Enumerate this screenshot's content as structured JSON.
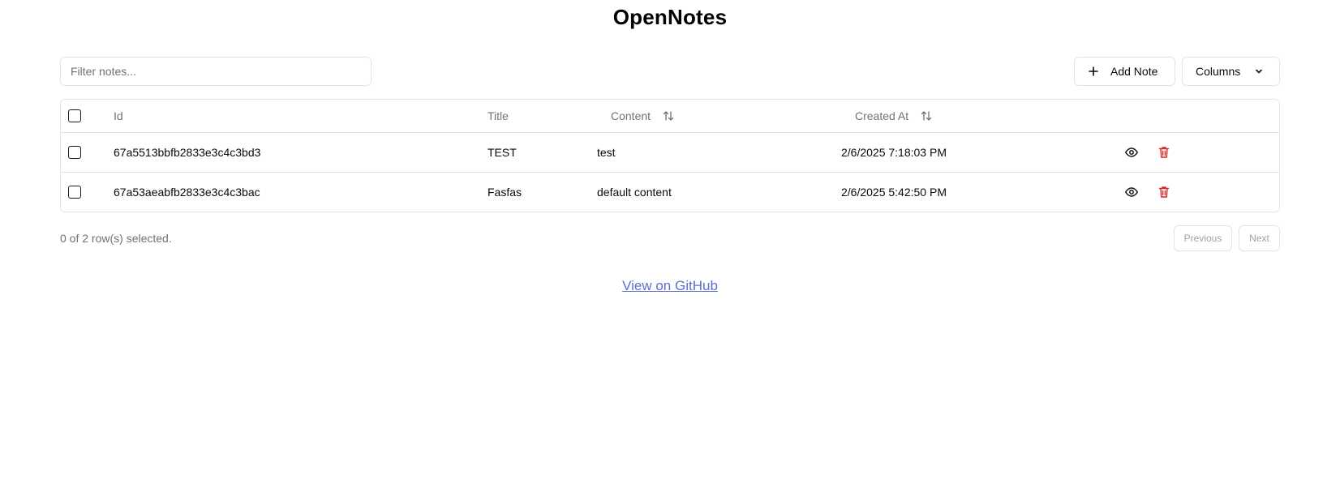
{
  "app": {
    "title": "OpenNotes"
  },
  "toolbar": {
    "filter_placeholder": "Filter notes...",
    "filter_value": "",
    "add_note_label": "Add Note",
    "columns_label": "Columns"
  },
  "table": {
    "headers": {
      "id": "Id",
      "title": "Title",
      "content": "Content",
      "created_at": "Created At"
    },
    "rows": [
      {
        "id": "67a5513bbfb2833e3c4c3bd3",
        "title": "TEST",
        "content": "test",
        "created_at": "2/6/2025 7:18:03 PM",
        "selected": false
      },
      {
        "id": "67a53aeabfb2833e3c4c3bac",
        "title": "Fasfas",
        "content": "default content",
        "created_at": "2/6/2025 5:42:50 PM",
        "selected": false
      }
    ]
  },
  "footer": {
    "selection_status": "0 of 2 row(s) selected.",
    "previous_label": "Previous",
    "next_label": "Next",
    "github_link": "View on GitHub"
  },
  "icons": {
    "add": "plus-icon",
    "columns": "chevron-down-icon",
    "sort": "arrow-up-down-icon",
    "view": "eye-icon",
    "delete": "trash-icon"
  },
  "colors": {
    "delete_icon": "#dc2626",
    "link": "#5b6fcf",
    "muted_text": "#71717a",
    "border": "#e4e4e7"
  }
}
